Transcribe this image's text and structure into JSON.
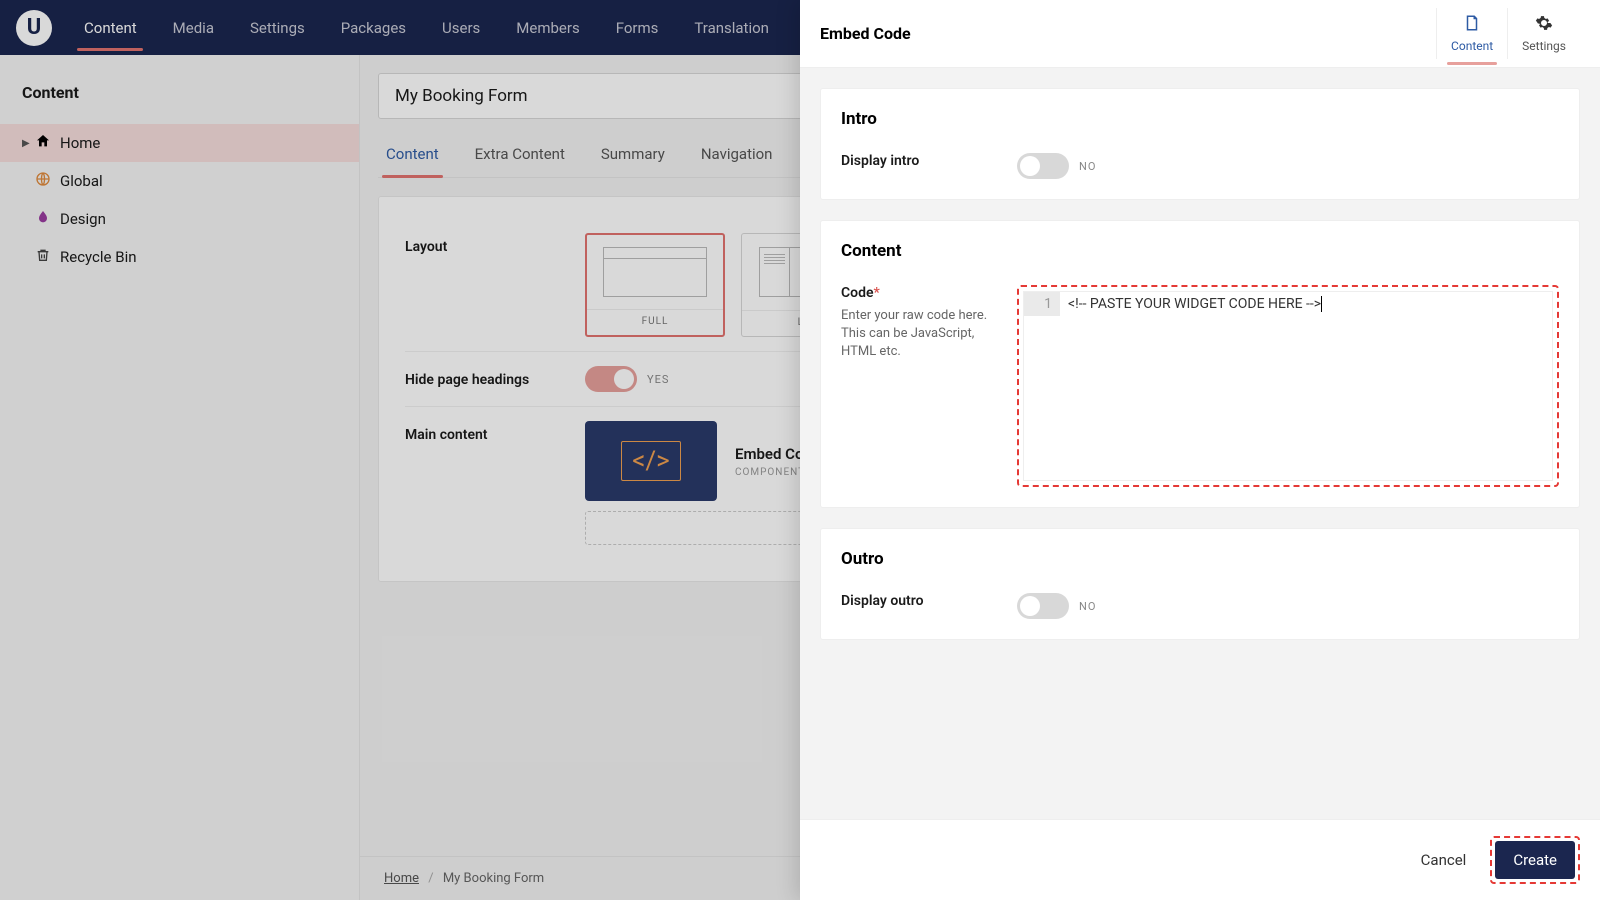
{
  "topnav": {
    "logo": "U",
    "items": [
      "Content",
      "Media",
      "Settings",
      "Packages",
      "Users",
      "Members",
      "Forms",
      "Translation"
    ],
    "active_index": 0
  },
  "sidebar": {
    "title": "Content",
    "tree": [
      {
        "label": "Home",
        "icon": "home",
        "active": true,
        "expandable": true
      },
      {
        "label": "Global",
        "icon": "globe"
      },
      {
        "label": "Design",
        "icon": "drop"
      },
      {
        "label": "Recycle Bin",
        "icon": "bin"
      }
    ]
  },
  "page": {
    "title_value": "My Booking Form",
    "tabs": [
      "Content",
      "Extra Content",
      "Summary",
      "Navigation"
    ],
    "active_tab": 0,
    "layout_label": "Layout",
    "layout_options": [
      "Full",
      "Left"
    ],
    "layout_selected": 0,
    "hide_headings_label": "Hide page headings",
    "hide_headings_on": true,
    "hide_headings_text": "YES",
    "main_content_label": "Main content",
    "embed_block": {
      "title": "Embed Code",
      "subtitle": "Component"
    }
  },
  "breadcrumb": {
    "root": "Home",
    "current": "My Booking Form"
  },
  "slideover": {
    "title": "Embed Code",
    "side_tabs": [
      {
        "label": "Content",
        "icon": "doc",
        "active": true
      },
      {
        "label": "Settings",
        "icon": "gear"
      }
    ],
    "sections": {
      "intro": {
        "heading": "Intro",
        "display_label": "Display intro",
        "display_on": false,
        "display_text": "NO"
      },
      "content": {
        "heading": "Content",
        "code_label": "Code",
        "code_required": "*",
        "code_help": "Enter your raw code here. This can be JavaScript, HTML etc.",
        "code_value": "<!-- PASTE YOUR WIDGET CODE HERE -->",
        "line_number": "1"
      },
      "outro": {
        "heading": "Outro",
        "display_label": "Display outro",
        "display_on": false,
        "display_text": "NO"
      }
    },
    "footer": {
      "cancel": "Cancel",
      "create": "Create"
    }
  }
}
